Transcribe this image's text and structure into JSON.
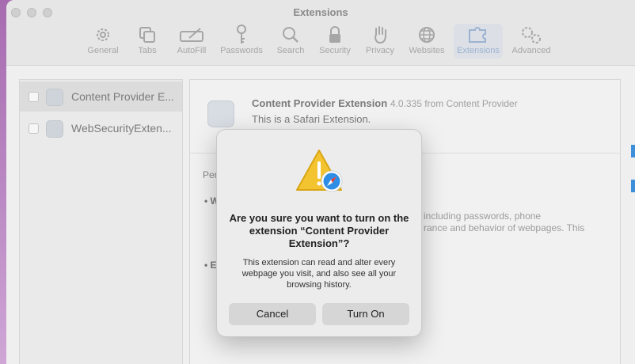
{
  "window": {
    "title": "Extensions"
  },
  "toolbar": {
    "items": [
      {
        "label": "General",
        "icon": "gear-icon"
      },
      {
        "label": "Tabs",
        "icon": "tabs-icon"
      },
      {
        "label": "AutoFill",
        "icon": "autofill-icon"
      },
      {
        "label": "Passwords",
        "icon": "key-icon"
      },
      {
        "label": "Search",
        "icon": "search-icon"
      },
      {
        "label": "Security",
        "icon": "lock-icon"
      },
      {
        "label": "Privacy",
        "icon": "hand-icon"
      },
      {
        "label": "Websites",
        "icon": "globe-icon"
      },
      {
        "label": "Extensions",
        "icon": "puzzle-icon",
        "active": true
      },
      {
        "label": "Advanced",
        "icon": "gears-icon"
      }
    ]
  },
  "sidebar": {
    "items": [
      {
        "label": "Content Provider E...",
        "selected": true
      },
      {
        "label": "WebSecurityExten...",
        "selected": false
      }
    ]
  },
  "detail": {
    "name": "Content Provider Extension",
    "version": "4.0.335 from Content Provider",
    "description": "This is a Safari Extension.",
    "perm_prefix": "Per",
    "bullet1": "• W",
    "line1": "including passwords, phone",
    "line2": "rance and behavior of webpages. This",
    "bullet2": "• E"
  },
  "dialog": {
    "title": "Are you sure you want to turn on the extension “Content Provider Extension”?",
    "message": "This extension can read and alter every webpage you visit, and also see all your browsing history.",
    "cancel_label": "Cancel",
    "confirm_label": "Turn On"
  },
  "colors": {
    "accent": "#3c8fd8",
    "warning": "#f4c430"
  }
}
